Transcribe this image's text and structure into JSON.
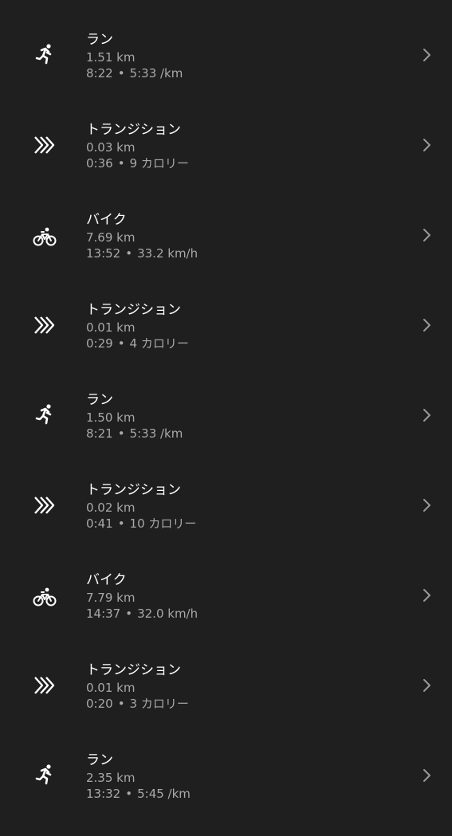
{
  "colors": {
    "background": "#1f1f1f",
    "primary_text": "#ffffff",
    "secondary_text": "#a8a8a8",
    "chevron": "#9a9a9a"
  },
  "segments": [
    {
      "type": "run",
      "icon": "running-icon",
      "title": "ラン",
      "distance": "1.51 km",
      "time": "8:22",
      "separator": "•",
      "detail": "5:33 /km"
    },
    {
      "type": "transition",
      "icon": "transition-icon",
      "title": "トランジション",
      "distance": "0.03 km",
      "time": "0:36",
      "separator": "•",
      "detail": "9 カロリー"
    },
    {
      "type": "bike",
      "icon": "cycling-icon",
      "title": "バイク",
      "distance": "7.69 km",
      "time": "13:52",
      "separator": "•",
      "detail": "33.2 km/h"
    },
    {
      "type": "transition",
      "icon": "transition-icon",
      "title": "トランジション",
      "distance": "0.01 km",
      "time": "0:29",
      "separator": "•",
      "detail": "4 カロリー"
    },
    {
      "type": "run",
      "icon": "running-icon",
      "title": "ラン",
      "distance": "1.50 km",
      "time": "8:21",
      "separator": "•",
      "detail": "5:33 /km"
    },
    {
      "type": "transition",
      "icon": "transition-icon",
      "title": "トランジション",
      "distance": "0.02 km",
      "time": "0:41",
      "separator": "•",
      "detail": "10 カロリー"
    },
    {
      "type": "bike",
      "icon": "cycling-icon",
      "title": "バイク",
      "distance": "7.79 km",
      "time": "14:37",
      "separator": "•",
      "detail": "32.0 km/h"
    },
    {
      "type": "transition",
      "icon": "transition-icon",
      "title": "トランジション",
      "distance": "0.01 km",
      "time": "0:20",
      "separator": "•",
      "detail": "3 カロリー"
    },
    {
      "type": "run",
      "icon": "running-icon",
      "title": "ラン",
      "distance": "2.35 km",
      "time": "13:32",
      "separator": "•",
      "detail": "5:45 /km"
    }
  ]
}
